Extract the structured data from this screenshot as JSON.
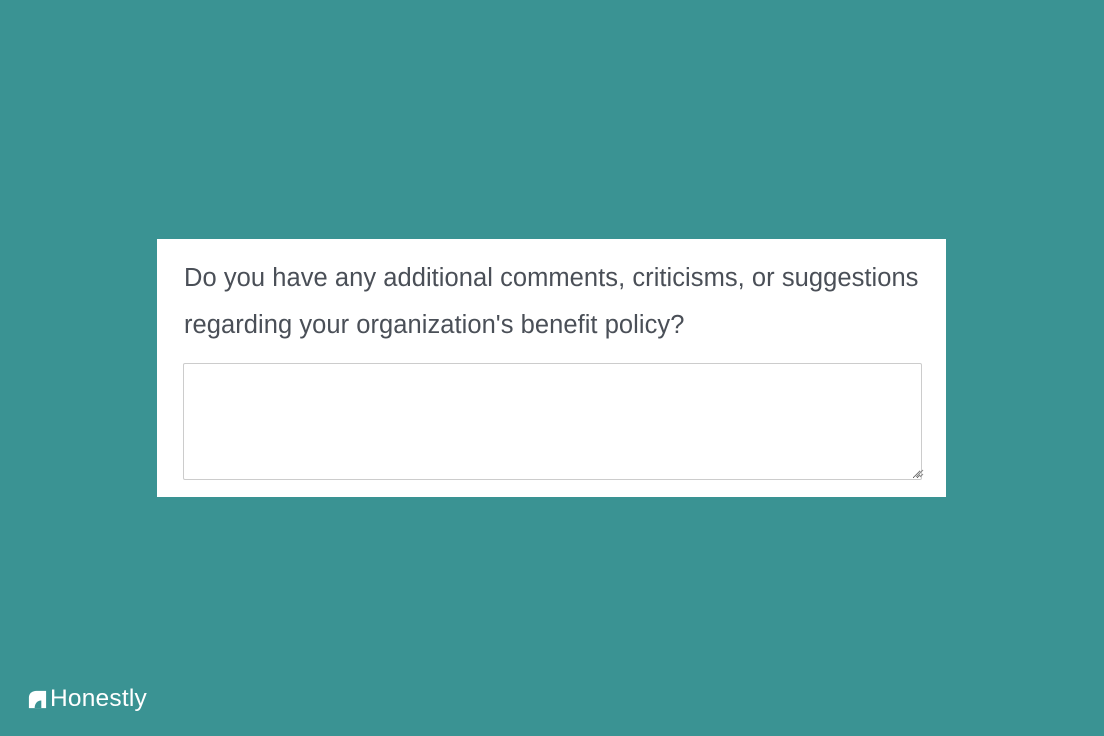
{
  "survey": {
    "question": "Do you have any additional comments, criticisms, or suggestions regarding your organization's benefit policy?",
    "answer_value": "",
    "answer_placeholder": ""
  },
  "brand": {
    "name": "Honestly",
    "icon": "honestly-logo-icon"
  },
  "colors": {
    "background": "#3a9393",
    "card": "#ffffff",
    "text": "#4a4f57",
    "border": "#cccccc"
  }
}
